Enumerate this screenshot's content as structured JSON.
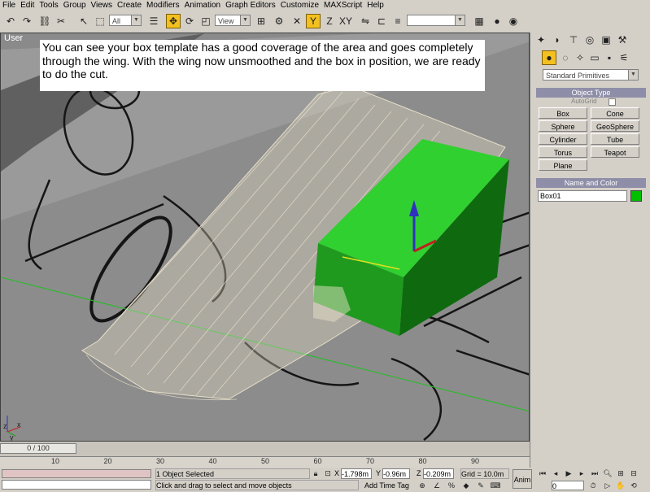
{
  "menu": [
    "File",
    "Edit",
    "Tools",
    "Group",
    "Views",
    "Create",
    "Modifiers",
    "Animation",
    "Graph Editors",
    "Customize",
    "MAXScript",
    "Help"
  ],
  "toolbar": {
    "selection_filter": "All",
    "reference_coord": "View",
    "named_selection": ""
  },
  "viewport": {
    "label": "User",
    "caption": "You can see your box template has a good coverage of the area and goes completely through the wing.  With the wing now unsmoothed and the box in position, we are ready to do the cut.",
    "axis_labels": {
      "x": "x",
      "y": "y",
      "z": "z"
    },
    "colors": {
      "box": "#1f9a1f",
      "box_dark": "#0f6a0f",
      "box_light": "#30d030",
      "wing": "#e8e0c8",
      "background": "#8a8a8a"
    }
  },
  "command_panel": {
    "category": "Standard Primitives",
    "object_type_title": "Object Type",
    "autogrid_label": "AutoGrid",
    "buttons": [
      "Box",
      "Cone",
      "Sphere",
      "GeoSphere",
      "Cylinder",
      "Tube",
      "Torus",
      "Teapot",
      "Plane"
    ],
    "name_color_title": "Name and Color",
    "object_name": "Box01",
    "object_color": "#00c000"
  },
  "timeline": {
    "frame": "0 / 100",
    "ticks": [
      "10",
      "20",
      "30",
      "40",
      "50",
      "60",
      "70",
      "80",
      "90"
    ]
  },
  "status": {
    "selection": "1 Object Selected",
    "prompt": "Click and drag to select and move objects",
    "x_label": "X",
    "x_value": "-1.798m",
    "y_label": "Y",
    "y_value": "-0.96m",
    "z_label": "Z",
    "z_value": "-0.209m",
    "grid": "Grid = 10.0m",
    "add_time_tag": "Add Time Tag",
    "auto_key": "Anim",
    "frame_field": "0"
  }
}
